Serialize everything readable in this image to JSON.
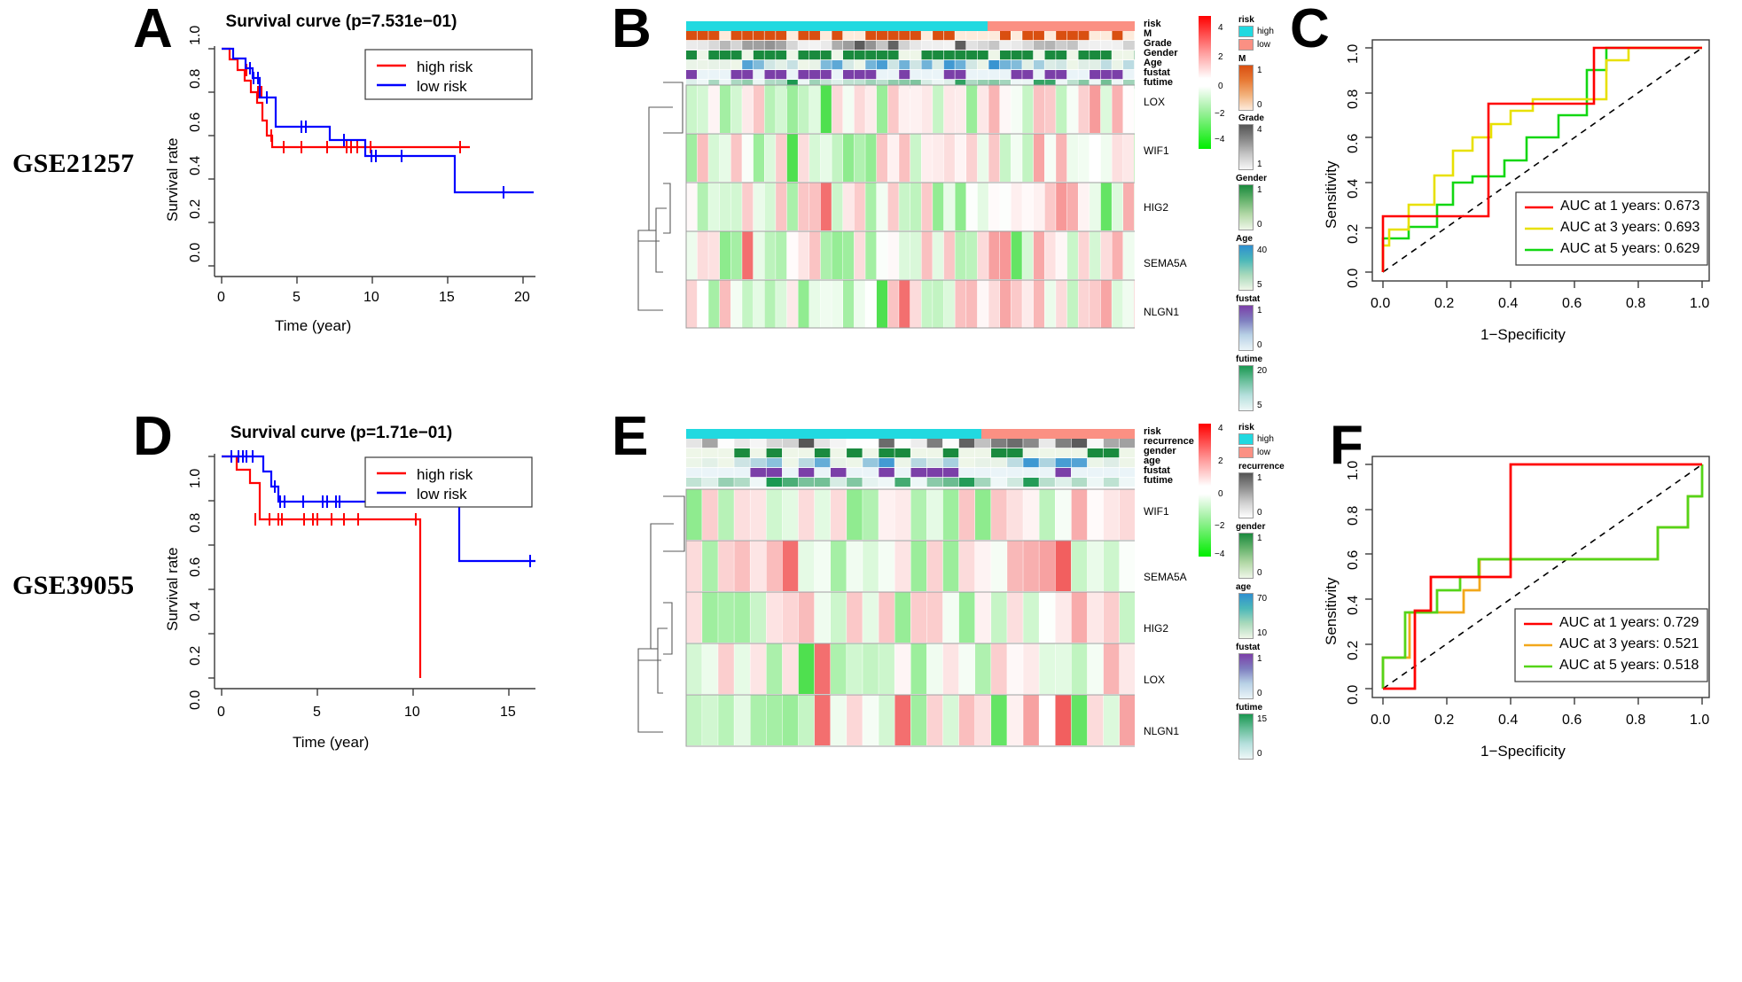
{
  "figure": {
    "row_labels": [
      {
        "id": "row-label-gse21257",
        "text": "GSE21257"
      },
      {
        "id": "row-label-gse39055",
        "text": "GSE39055"
      }
    ],
    "panel_letters": [
      "A",
      "B",
      "C",
      "D",
      "E",
      "F"
    ]
  },
  "panelA": {
    "letter": "A",
    "title": "Survival curve (p=7.531e−01)",
    "xlabel": "Time (year)",
    "ylabel": "Survival rate",
    "xticks": [
      "0",
      "5",
      "10",
      "15",
      "20"
    ],
    "yticks": [
      "0.0",
      "0.2",
      "0.4",
      "0.6",
      "0.8",
      "1.0"
    ],
    "legend": [
      {
        "label": "high risk",
        "color": "#ff0000"
      },
      {
        "label": "low risk",
        "color": "#0000ff"
      }
    ]
  },
  "panelD": {
    "letter": "D",
    "title": "Survival curve (p=1.71e−01)",
    "xlabel": "Time (year)",
    "ylabel": "Survival rate",
    "xticks": [
      "0",
      "5",
      "10",
      "15"
    ],
    "yticks": [
      "0.0",
      "0.2",
      "0.4",
      "0.6",
      "0.8",
      "1.0"
    ],
    "legend": [
      {
        "label": "high risk",
        "color": "#ff0000"
      },
      {
        "label": "low risk",
        "color": "#0000ff"
      }
    ]
  },
  "panelB": {
    "letter": "B",
    "annotation_rows": [
      "risk",
      "M",
      "Grade",
      "Gender",
      "Age",
      "fustat",
      "futime"
    ],
    "gene_rows": [
      "LOX",
      "WIF1",
      "HIG2",
      "SEMA5A",
      "NLGN1"
    ],
    "colorbar": {
      "ticks": [
        "4",
        "2",
        "0",
        "−2",
        "−4"
      ],
      "high_color": "#ff0000",
      "mid_color": "#ffffff",
      "low_color": "#00ee00"
    },
    "legends": [
      {
        "name": "risk",
        "top_label": "high",
        "bottom_label": "low",
        "top_color": "#21d9e0",
        "bottom_color": "#fb9083",
        "discrete": true
      },
      {
        "name": "M",
        "top_label": "1",
        "bottom_label": "0",
        "top_color": "#d94f11",
        "bottom_color": "#fdebdc"
      },
      {
        "name": "Grade",
        "top_label": "4",
        "bottom_label": "1",
        "top_color": "#555555",
        "bottom_color": "#f7f7f7"
      },
      {
        "name": "Gender",
        "top_label": "1",
        "bottom_label": "0",
        "top_color": "#1a8a3e",
        "bottom_color": "#eef6e8"
      },
      {
        "name": "Age",
        "top_label": "40",
        "bottom_label": "5",
        "top_color": "#2e8fd0",
        "bottom_color": "#eef6e8"
      },
      {
        "name": "fustat",
        "top_label": "1",
        "bottom_label": "0",
        "top_color": "#7b3fa8",
        "bottom_color": "#eaf4f8"
      },
      {
        "name": "futime",
        "top_label": "20",
        "bottom_label": "5",
        "top_color": "#1a9850",
        "bottom_color": "#eef7f7"
      }
    ]
  },
  "panelE": {
    "letter": "E",
    "annotation_rows": [
      "risk",
      "recurrence",
      "gender",
      "age",
      "fustat",
      "futime"
    ],
    "gene_rows": [
      "WIF1",
      "SEMA5A",
      "HIG2",
      "LOX",
      "NLGN1"
    ],
    "colorbar": {
      "ticks": [
        "4",
        "2",
        "0",
        "−2",
        "−4"
      ],
      "high_color": "#ff0000",
      "mid_color": "#ffffff",
      "low_color": "#00ee00"
    },
    "legends": [
      {
        "name": "risk",
        "top_label": "high",
        "bottom_label": "low",
        "top_color": "#21d9e0",
        "bottom_color": "#fb9083",
        "discrete": true
      },
      {
        "name": "recurrence",
        "top_label": "1",
        "bottom_label": "0",
        "top_color": "#555555",
        "bottom_color": "#ffffff"
      },
      {
        "name": "gender",
        "top_label": "1",
        "bottom_label": "0",
        "top_color": "#1a8a3e",
        "bottom_color": "#eef6e8"
      },
      {
        "name": "age",
        "top_label": "70",
        "bottom_label": "10",
        "top_color": "#2e8fd0",
        "bottom_color": "#eef6e8"
      },
      {
        "name": "fustat",
        "top_label": "1",
        "bottom_label": "0",
        "top_color": "#7b3fa8",
        "bottom_color": "#eaf4f8"
      },
      {
        "name": "futime",
        "top_label": "15",
        "bottom_label": "0",
        "top_color": "#1a9850",
        "bottom_color": "#eef7f7"
      }
    ]
  },
  "panelC": {
    "letter": "C",
    "xlabel": "1−Specificity",
    "ylabel": "Sensitivity",
    "xticks": [
      "0.0",
      "0.2",
      "0.4",
      "0.6",
      "0.8",
      "1.0"
    ],
    "yticks": [
      "0.0",
      "0.2",
      "0.4",
      "0.6",
      "0.8",
      "1.0"
    ],
    "legend": [
      {
        "label": "AUC at 1 years: 0.673",
        "color": "#ff0000"
      },
      {
        "label": "AUC at 3 years: 0.693",
        "color": "#e8e000"
      },
      {
        "label": "AUC at 5 years: 0.629",
        "color": "#12d712"
      }
    ]
  },
  "panelF": {
    "letter": "F",
    "xlabel": "1−Specificity",
    "ylabel": "Sensitivity",
    "xticks": [
      "0.0",
      "0.2",
      "0.4",
      "0.6",
      "0.8",
      "1.0"
    ],
    "yticks": [
      "0.0",
      "0.2",
      "0.4",
      "0.6",
      "0.8",
      "1.0"
    ],
    "legend": [
      {
        "label": "AUC at 1 years: 0.729",
        "color": "#ff0000"
      },
      {
        "label": "AUC at 3 years: 0.521",
        "color": "#f2a71b"
      },
      {
        "label": "AUC at 5 years: 0.518",
        "color": "#55d418"
      }
    ]
  },
  "chart_data": [
    {
      "type": "line",
      "id": "panelA-km",
      "title": "Survival curve (p=7.531e−01)",
      "xlabel": "Time (year)",
      "ylabel": "Survival rate",
      "xlim": [
        0,
        21.5
      ],
      "ylim": [
        0,
        1.02
      ],
      "grid": false,
      "legend_position": "top-right",
      "series": [
        {
          "name": "high risk",
          "color": "#ff0000",
          "type": "step",
          "x": [
            0,
            0.55,
            0.55,
            1.6,
            1.6,
            2.0,
            2.0,
            2.35,
            2.35,
            2.55,
            2.55,
            2.8,
            2.8,
            3.1,
            3.1,
            3.35,
            3.35,
            16.0
          ],
          "y": [
            1.0,
            1.0,
            0.95,
            0.95,
            0.9,
            0.9,
            0.85,
            0.85,
            0.8,
            0.8,
            0.75,
            0.75,
            0.67,
            0.67,
            0.6,
            0.6,
            0.545,
            0.545
          ],
          "censor_x": [
            1.7,
            2.45,
            2.55,
            3.2,
            4.1,
            5.3,
            7.0,
            8.3,
            8.6,
            9.0,
            9.9,
            15.8
          ],
          "censor_y": [
            0.9,
            0.8,
            0.8,
            0.6,
            0.545,
            0.545,
            0.545,
            0.545,
            0.545,
            0.545,
            0.545,
            0.545
          ]
        },
        {
          "name": "low risk",
          "color": "#0000ff",
          "type": "step",
          "x": [
            0,
            0.75,
            0.75,
            1.55,
            1.55,
            2.0,
            2.0,
            2.5,
            2.5,
            3.6,
            3.6,
            7.15,
            7.15,
            8.4,
            8.4,
            9.5,
            9.5,
            15.5,
            15.5,
            20.7
          ],
          "y": [
            1.0,
            1.0,
            0.955,
            0.955,
            0.91,
            0.91,
            0.865,
            0.865,
            0.775,
            0.775,
            0.64,
            0.64,
            0.58,
            0.58,
            0.58,
            0.58,
            0.505,
            0.505,
            0.335,
            0.335
          ],
          "censor_x": [
            1.9,
            2.1,
            2.4,
            3.0,
            5.3,
            5.6,
            8.1,
            9.9,
            10.2,
            11.9,
            18.7
          ],
          "censor_y": [
            0.91,
            0.865,
            0.865,
            0.775,
            0.64,
            0.64,
            0.58,
            0.505,
            0.505,
            0.505,
            0.335
          ]
        }
      ]
    },
    {
      "type": "line",
      "id": "panelD-km",
      "title": "Survival curve (p=1.71e−01)",
      "xlabel": "Time (year)",
      "ylabel": "Survival rate",
      "xlim": [
        0,
        16.8
      ],
      "ylim": [
        0,
        1.02
      ],
      "grid": false,
      "legend_position": "top-right",
      "series": [
        {
          "name": "high risk",
          "color": "#ff0000",
          "type": "step",
          "x": [
            0,
            0.8,
            0.8,
            1.5,
            1.5,
            2.0,
            2.0,
            10.35,
            10.35
          ],
          "y": [
            1.0,
            1.0,
            0.94,
            0.94,
            0.88,
            0.88,
            0.715,
            0.715,
            0.0
          ],
          "censor_x": [
            1.75,
            2.5,
            2.95,
            3.1,
            4.3,
            4.75,
            4.95,
            5.7,
            6.4,
            7.1,
            10.1
          ],
          "censor_y": [
            0.88,
            0.715,
            0.715,
            0.715,
            0.715,
            0.715,
            0.715,
            0.715,
            0.715,
            0.715,
            0.715
          ]
        },
        {
          "name": "low risk",
          "color": "#0000ff",
          "type": "step",
          "x": [
            0,
            2.15,
            2.15,
            2.55,
            2.55,
            2.9,
            2.9,
            12.4,
            12.4,
            16.4
          ],
          "y": [
            1.0,
            1.0,
            0.93,
            0.93,
            0.865,
            0.865,
            0.795,
            0.795,
            0.53,
            0.53
          ],
          "censor_x": [
            0.5,
            0.85,
            1.05,
            1.25,
            1.6,
            2.75,
            3.0,
            3.2,
            4.2,
            5.2,
            5.4,
            5.9,
            6.05,
            16.2
          ],
          "censor_y": [
            1.0,
            1.0,
            1.0,
            1.0,
            1.0,
            0.865,
            0.795,
            0.795,
            0.795,
            0.795,
            0.795,
            0.795,
            0.795,
            0.53
          ]
        }
      ]
    },
    {
      "type": "line",
      "id": "panelC-roc",
      "title": "",
      "xlabel": "1−Specificity",
      "ylabel": "Sensitivity",
      "xlim": [
        0,
        1
      ],
      "ylim": [
        0,
        1
      ],
      "grid": false,
      "legend_position": "bottom-right",
      "reference_line": {
        "from": [
          0,
          0
        ],
        "to": [
          1,
          1
        ],
        "style": "dashed",
        "color": "#000000"
      },
      "series": [
        {
          "name": "AUC at 1 years: 0.673",
          "auc": 0.673,
          "color": "#ff0000",
          "type": "step",
          "x": [
            0.0,
            0.0,
            0.05,
            0.05,
            0.33,
            0.33,
            0.63,
            0.66,
            0.66,
            1.0
          ],
          "y": [
            0.0,
            0.25,
            0.25,
            0.25,
            0.25,
            0.75,
            0.75,
            0.75,
            1.0,
            1.0
          ]
        },
        {
          "name": "AUC at 3 years: 0.693",
          "auc": 0.693,
          "color": "#e8e000",
          "type": "step",
          "x": [
            0.0,
            0.0,
            0.02,
            0.02,
            0.08,
            0.08,
            0.16,
            0.16,
            0.22,
            0.22,
            0.28,
            0.28,
            0.34,
            0.34,
            0.4,
            0.4,
            0.47,
            0.47,
            0.66,
            0.66,
            0.72,
            0.72,
            1.0
          ],
          "y": [
            0.0,
            0.12,
            0.12,
            0.19,
            0.19,
            0.3,
            0.3,
            0.43,
            0.43,
            0.54,
            0.54,
            0.6,
            0.6,
            0.66,
            0.66,
            0.72,
            0.72,
            0.77,
            0.77,
            0.94,
            0.94,
            1.0,
            1.0
          ]
        },
        {
          "name": "AUC at 5 years: 0.629",
          "auc": 0.629,
          "color": "#12d712",
          "type": "step",
          "x": [
            0.0,
            0.0,
            0.08,
            0.08,
            0.17,
            0.17,
            0.22,
            0.22,
            0.28,
            0.28,
            0.38,
            0.38,
            0.45,
            0.45,
            0.55,
            0.55,
            0.64,
            0.64,
            0.7,
            0.7,
            1.0
          ],
          "y": [
            0.0,
            0.15,
            0.15,
            0.2,
            0.2,
            0.3,
            0.3,
            0.4,
            0.4,
            0.43,
            0.43,
            0.5,
            0.5,
            0.6,
            0.6,
            0.7,
            0.7,
            0.9,
            0.9,
            1.0,
            1.0
          ]
        }
      ]
    },
    {
      "type": "line",
      "id": "panelF-roc",
      "title": "",
      "xlabel": "1−Specificity",
      "ylabel": "Sensitivity",
      "xlim": [
        0,
        1
      ],
      "ylim": [
        0,
        1
      ],
      "grid": false,
      "legend_position": "bottom-right",
      "reference_line": {
        "from": [
          0,
          0
        ],
        "to": [
          1,
          1
        ],
        "style": "dashed",
        "color": "#000000"
      },
      "series": [
        {
          "name": "AUC at 1 years: 0.729",
          "auc": 0.729,
          "color": "#ff0000",
          "type": "step",
          "x": [
            0.0,
            0.0,
            0.1,
            0.1,
            0.15,
            0.15,
            0.4,
            0.4,
            1.0
          ],
          "y": [
            0.0,
            0.0,
            0.0,
            0.35,
            0.35,
            0.5,
            0.5,
            1.0,
            1.0
          ]
        },
        {
          "name": "AUC at 3 years: 0.521",
          "auc": 0.521,
          "color": "#f2a71b",
          "type": "step",
          "x": [
            0.0,
            0.0,
            0.08,
            0.08,
            0.17,
            0.17,
            0.22,
            0.22,
            0.27,
            0.27,
            0.86,
            0.86,
            0.95,
            0.95,
            1.0
          ],
          "y": [
            0.0,
            0.14,
            0.14,
            0.34,
            0.34,
            0.44,
            0.44,
            0.58,
            0.58,
            0.58,
            0.58,
            0.715,
            0.715,
            0.86,
            0.86
          ]
        },
        {
          "name": "AUC at 5 years: 0.518",
          "auc": 0.518,
          "color": "#55d418",
          "type": "step",
          "x": [
            0.0,
            0.0,
            0.07,
            0.07,
            0.17,
            0.17,
            0.24,
            0.24,
            0.3,
            0.3,
            0.86,
            0.86,
            0.95,
            0.95,
            1.0,
            1.0
          ],
          "y": [
            0.0,
            0.14,
            0.14,
            0.34,
            0.34,
            0.44,
            0.44,
            0.5,
            0.5,
            0.58,
            0.58,
            0.715,
            0.715,
            0.86,
            0.86,
            1.0
          ]
        }
      ]
    },
    {
      "type": "heatmap",
      "id": "panelB-heatmap",
      "title": "",
      "row_labels": [
        "LOX",
        "WIF1",
        "HIG2",
        "SEMA5A",
        "NLGN1"
      ],
      "annotation_tracks": [
        "risk",
        "M",
        "Grade",
        "Gender",
        "Age",
        "fustat",
        "futime"
      ],
      "n_columns": 53,
      "colorbar_range": [
        -4,
        4
      ],
      "colorbar_ticks": [
        4,
        2,
        0,
        -2,
        -4
      ]
    },
    {
      "type": "heatmap",
      "id": "panelE-heatmap",
      "title": "",
      "row_labels": [
        "WIF1",
        "SEMA5A",
        "HIG2",
        "LOX",
        "NLGN1"
      ],
      "annotation_tracks": [
        "risk",
        "recurrence",
        "gender",
        "age",
        "fustat",
        "futime"
      ],
      "n_columns": 37,
      "colorbar_range": [
        -4,
        4
      ],
      "colorbar_ticks": [
        4,
        2,
        0,
        -2,
        -4
      ]
    }
  ]
}
